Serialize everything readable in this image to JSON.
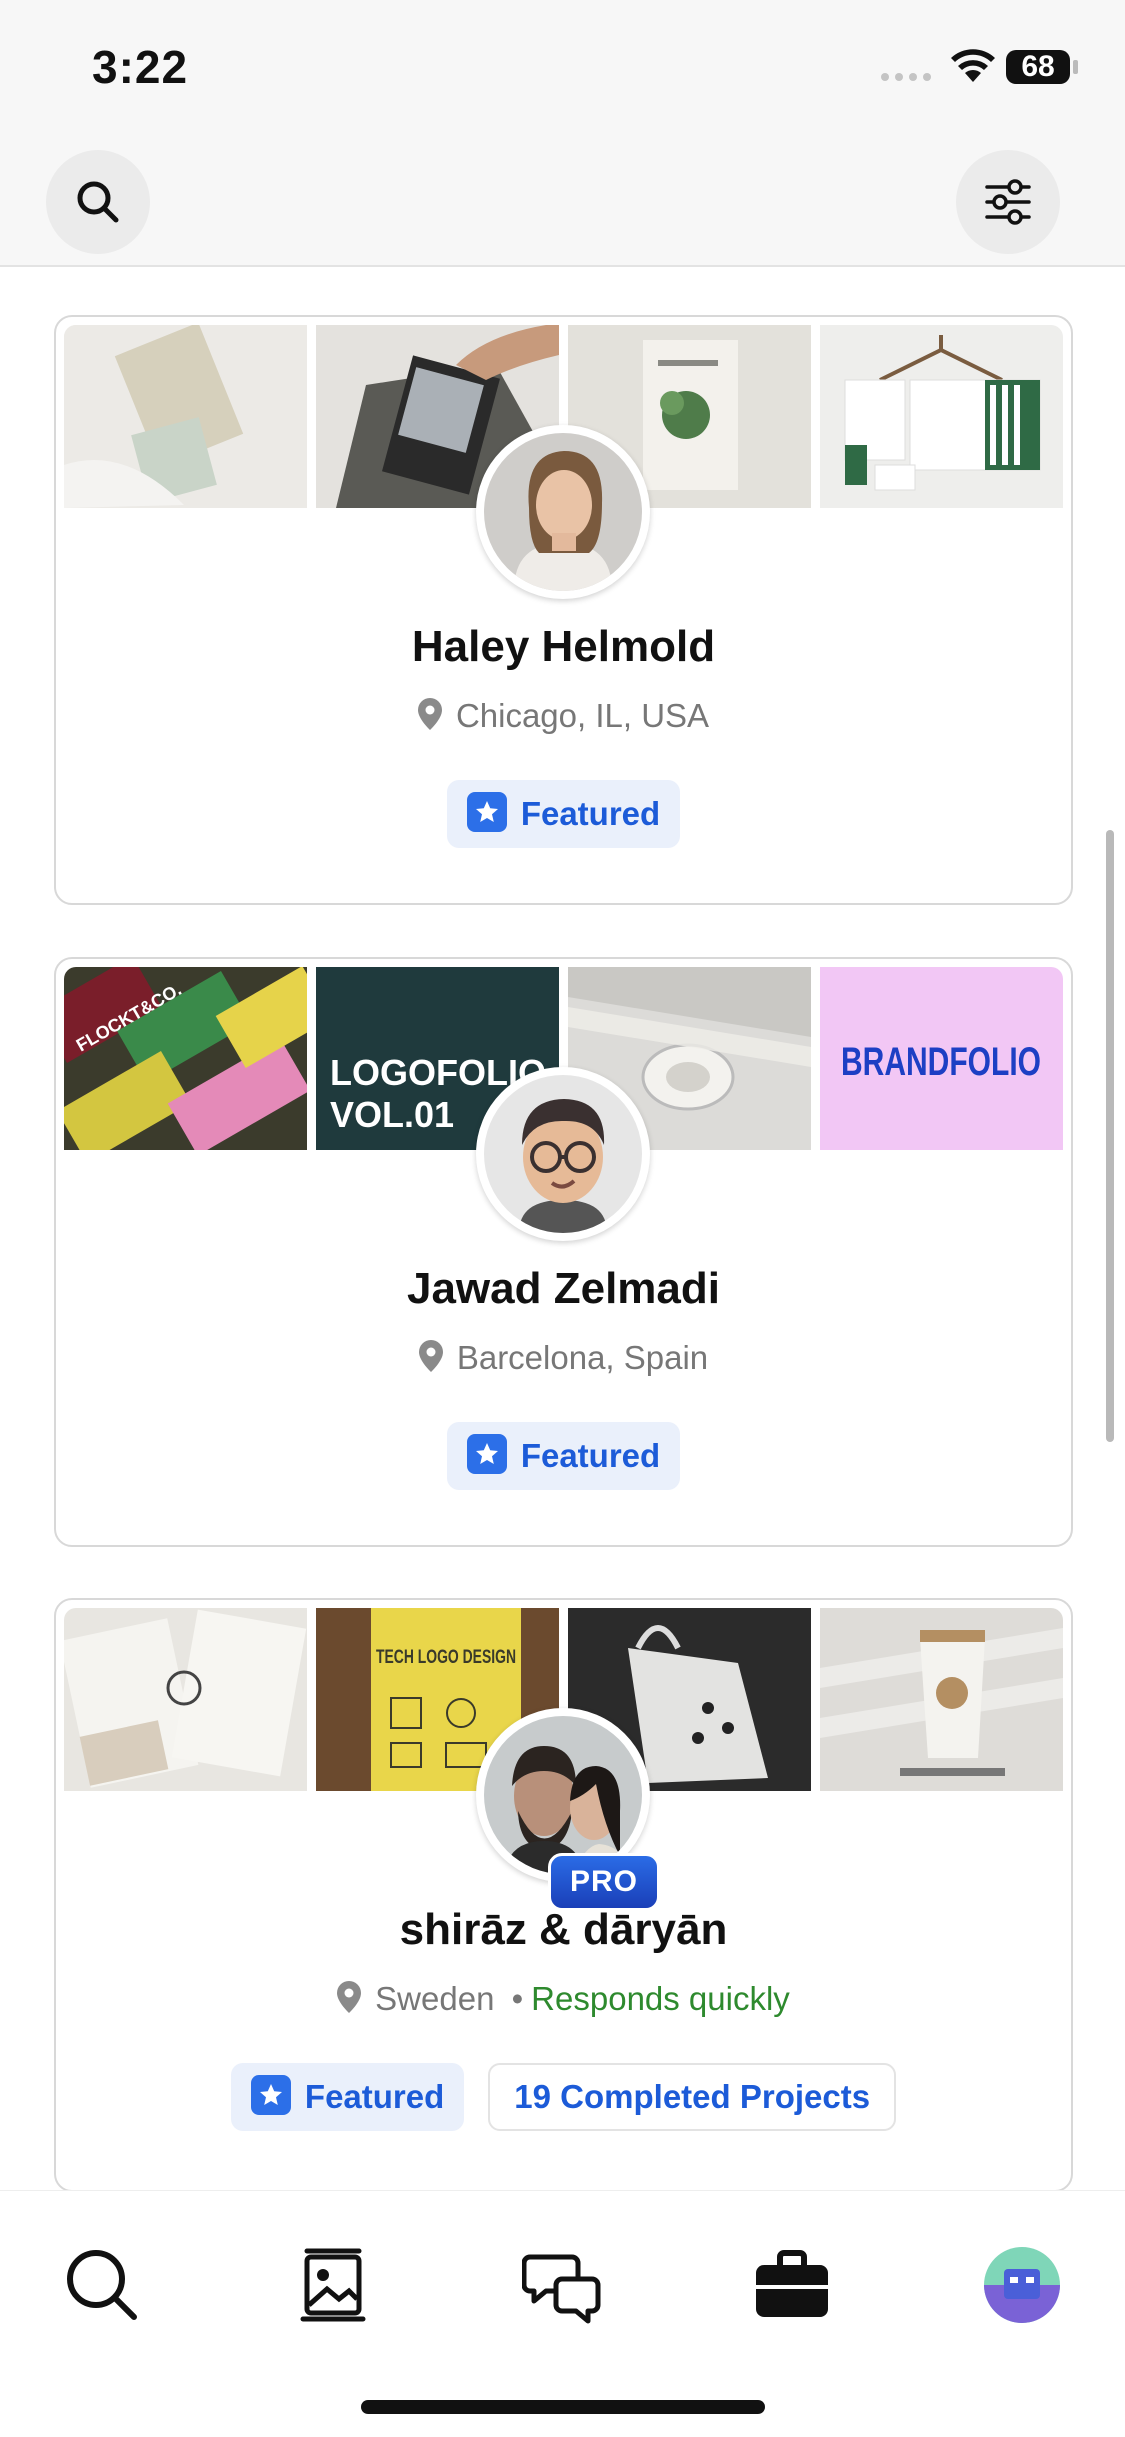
{
  "status_bar": {
    "time": "3:22",
    "battery": "68"
  },
  "header": {
    "left_icon": "search-icon",
    "right_icon": "filter-sliders-icon"
  },
  "cards": [
    {
      "name": "Haley Helmold",
      "location": "Chicago, IL, USA",
      "responds": "",
      "pro": "",
      "featured": "Featured",
      "projects": ""
    },
    {
      "name": "Jawad Zelmadi",
      "location": "Barcelona, Spain",
      "responds": "",
      "pro": "",
      "featured": "Featured",
      "projects": ""
    },
    {
      "name": "shirāz & dāryān",
      "location": "Sweden",
      "separator": "•",
      "responds": "Responds quickly",
      "pro": "PRO",
      "featured": "Featured",
      "projects": "19 Completed Projects"
    }
  ],
  "thumb_text": {
    "logofolio_1": "LOGOFOLIO",
    "logofolio_2": "VOL.01",
    "brandfolio": "BRANDFOLIO",
    "flockt": "FLOCKT&CO.",
    "tech_logo": "TECH LOGO DESIGN"
  },
  "tabbar": {
    "items": [
      "search-icon",
      "gallery-icon",
      "messages-icon",
      "briefcase-icon",
      "profile-avatar-icon"
    ]
  },
  "colors": {
    "accent": "#1c5bd8",
    "featured_bg": "#eaf0fb",
    "responds": "#2e8a2e",
    "logofolio_bg": "#1f3a3d",
    "brandfolio_bg": "#f2c7f5",
    "brandfolio_text": "#1d3fc4"
  }
}
